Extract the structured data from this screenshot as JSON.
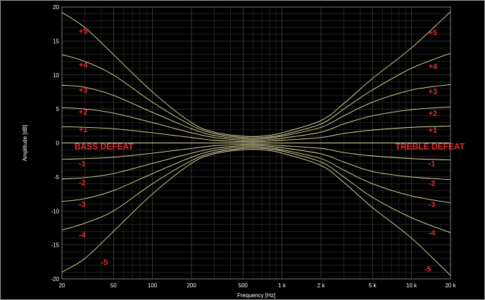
{
  "chart_data": {
    "type": "line",
    "title": "",
    "xlabel": "Frequency [Hz]",
    "ylabel": "Amplitude [dB]",
    "x_scale": "log",
    "xlim": [
      20,
      20000
    ],
    "ylim": [
      -20,
      20
    ],
    "grid": true,
    "x_tick_values": [
      20,
      50,
      100,
      200,
      500,
      1000,
      2000,
      5000,
      10000,
      20000
    ],
    "x_tick_labels": [
      "20",
      "50",
      "100",
      "200",
      "500",
      "1 k",
      "2 k",
      "5 k",
      "10 k",
      "20 k"
    ],
    "y_ticks": [
      20,
      15,
      10,
      5,
      0,
      -5,
      -10,
      -15,
      -20
    ],
    "x": [
      20,
      30,
      50,
      100,
      200,
      300,
      500,
      700,
      1000,
      2000,
      3000,
      5000,
      10000,
      20000
    ],
    "series": [
      {
        "values": [
          19.2,
          17.0,
          13.0,
          7.5,
          3.0,
          1.6,
          1.0,
          1.0,
          1.5,
          3.3,
          5.8,
          9.5,
          14.0,
          19.3
        ]
      },
      {
        "values": [
          13.0,
          12.0,
          10.0,
          6.0,
          2.6,
          1.4,
          0.8,
          0.8,
          1.2,
          2.8,
          5.0,
          7.8,
          11.0,
          13.2
        ]
      },
      {
        "values": [
          8.5,
          8.2,
          7.0,
          4.5,
          2.1,
          1.1,
          0.6,
          0.6,
          1.0,
          2.3,
          4.0,
          6.0,
          7.8,
          8.6
        ]
      },
      {
        "values": [
          5.2,
          5.0,
          4.4,
          3.0,
          1.5,
          0.8,
          0.4,
          0.4,
          0.7,
          1.6,
          2.8,
          4.0,
          4.9,
          5.3
        ]
      },
      {
        "values": [
          2.4,
          2.3,
          2.1,
          1.5,
          0.8,
          0.4,
          0.2,
          0.2,
          0.4,
          0.8,
          1.4,
          1.9,
          2.3,
          2.5
        ]
      },
      {
        "values": [
          0,
          0,
          0,
          0,
          0,
          0,
          0,
          0,
          0,
          0,
          0,
          0,
          0,
          0
        ]
      },
      {
        "values": [
          -2.4,
          -2.3,
          -2.1,
          -1.5,
          -0.8,
          -0.4,
          -0.2,
          -0.2,
          -0.4,
          -0.8,
          -1.4,
          -1.9,
          -2.3,
          -2.5
        ]
      },
      {
        "values": [
          -5.3,
          -5.1,
          -4.5,
          -3.0,
          -1.5,
          -0.8,
          -0.4,
          -0.4,
          -0.7,
          -1.6,
          -2.8,
          -4.2,
          -5.0,
          -5.4
        ]
      },
      {
        "values": [
          -8.6,
          -8.2,
          -7.0,
          -4.5,
          -2.1,
          -1.1,
          -0.6,
          -0.6,
          -1.0,
          -2.3,
          -4.0,
          -6.0,
          -7.8,
          -8.8
        ]
      },
      {
        "values": [
          -12.8,
          -11.8,
          -10.0,
          -6.0,
          -2.6,
          -1.4,
          -0.8,
          -0.8,
          -1.2,
          -2.8,
          -5.0,
          -8.0,
          -11.0,
          -13.2
        ]
      },
      {
        "values": [
          -19.0,
          -17.0,
          -13.0,
          -7.5,
          -3.0,
          -1.6,
          -1.0,
          -1.0,
          -1.5,
          -3.3,
          -5.8,
          -9.5,
          -14.0,
          -19.5
        ]
      }
    ],
    "annotations": [
      {
        "text": "+5",
        "x": 27,
        "y": 16.5
      },
      {
        "text": "+4",
        "x": 27,
        "y": 11.5
      },
      {
        "text": "+3",
        "x": 27,
        "y": 7.8
      },
      {
        "text": "+2",
        "x": 27,
        "y": 4.6
      },
      {
        "text": "+1",
        "x": 27,
        "y": 2.0
      },
      {
        "text": "BASS DEFEAT",
        "x": 25,
        "y": -0.5,
        "big": true
      },
      {
        "text": "-1",
        "x": 27,
        "y": -3.0
      },
      {
        "text": "-2",
        "x": 27,
        "y": -5.8
      },
      {
        "text": "-3",
        "x": 27,
        "y": -9.0
      },
      {
        "text": "-4",
        "x": 27,
        "y": -13.5
      },
      {
        "text": "-5",
        "x": 40,
        "y": -17.5
      },
      {
        "text": "+5",
        "x": 13500,
        "y": 16.3
      },
      {
        "text": "+4",
        "x": 13500,
        "y": 11.3
      },
      {
        "text": "+3",
        "x": 13500,
        "y": 7.6
      },
      {
        "text": "+2",
        "x": 13500,
        "y": 4.4
      },
      {
        "text": "+1",
        "x": 13500,
        "y": 1.9
      },
      {
        "text": "TREBLE DEFEAT",
        "x": 7500,
        "y": -0.5,
        "big": true
      },
      {
        "text": "-1",
        "x": 13500,
        "y": -3.0
      },
      {
        "text": "-2",
        "x": 13500,
        "y": -5.9
      },
      {
        "text": "-3",
        "x": 13500,
        "y": -9.0
      },
      {
        "text": "-4",
        "x": 13500,
        "y": -13.2
      },
      {
        "text": "-5",
        "x": 12500,
        "y": -18.5
      }
    ],
    "colors": {
      "background": "#000000",
      "grid_major": "#5a5a5a",
      "grid_minor": "#333333",
      "curve": "#e6e2a6",
      "annotation": "#e03030",
      "text": "#ffffff"
    }
  }
}
